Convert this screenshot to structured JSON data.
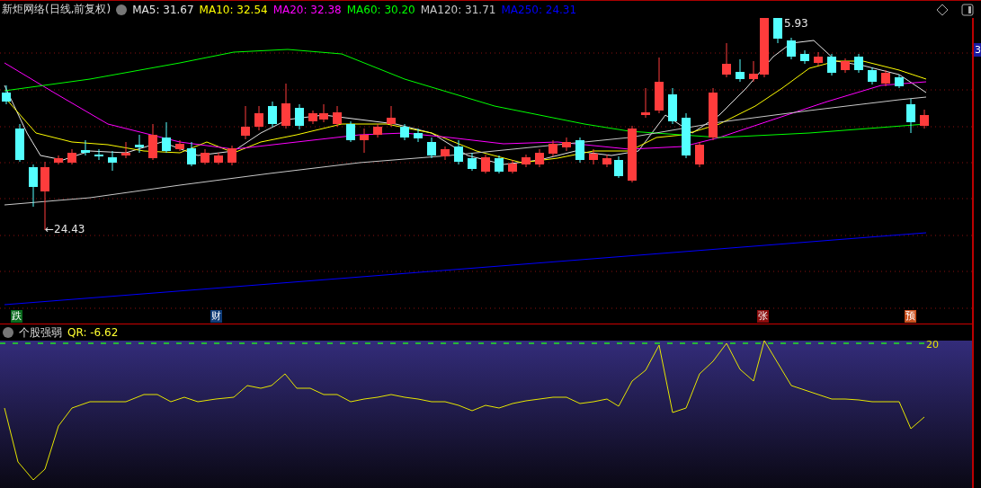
{
  "title": "新炬网络(日线,前复权)",
  "indicators": [
    {
      "label": "MA5: 31.67",
      "color": "#e6e6e6"
    },
    {
      "label": "MA10: 32.54",
      "color": "#ffff00"
    },
    {
      "label": "MA20: 32.38",
      "color": "#ff00ff"
    },
    {
      "label": "MA60: 30.20",
      "color": "#00ff00"
    },
    {
      "label": "MA120: 31.71",
      "color": "#c8c8c8"
    },
    {
      "label": "MA250: 24.31",
      "color": "#0000ff"
    }
  ],
  "price_chart": {
    "high_label": "5.93",
    "low_label": "←24.43",
    "price_tag": "3"
  },
  "event_markers": [
    {
      "text": "跌",
      "color": "#0a6b1e"
    },
    {
      "text": "财",
      "color": "#0f3c78"
    },
    {
      "text": "张",
      "color": "#8b0c0c"
    },
    {
      "text": "预",
      "color": "#c8501e"
    }
  ],
  "oscillator": {
    "title": "个股强弱",
    "reading": "QR: -6.62",
    "level_label": "20"
  }
}
